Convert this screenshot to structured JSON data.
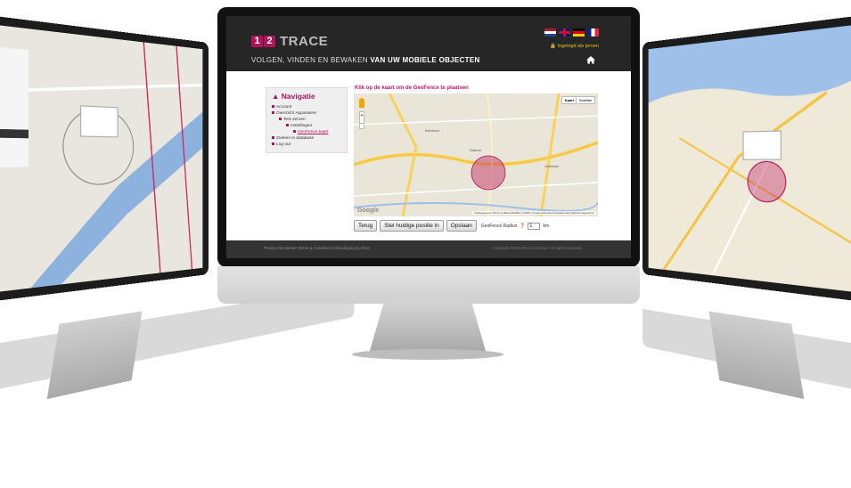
{
  "brand": {
    "logo_digit_1": "1",
    "logo_digit_2": "2",
    "logo_word": "TRACE",
    "tagline_normal": "VOLGEN, VINDEN EN BEWAKEN",
    "tagline_bold": "VAN UW MOBIELE OBJECTEN",
    "accent_color": "#b0125a",
    "header_color": "#262626"
  },
  "header": {
    "languages": [
      "nl",
      "en",
      "de",
      "fr"
    ],
    "login_status": "Ingelogd als jeroen",
    "home_icon": "home-icon"
  },
  "sidebar": {
    "title": "Navigatie",
    "items": [
      {
        "label": "Account",
        "level": 0
      },
      {
        "label": "Overzicht Apparatere",
        "level": 0
      },
      {
        "label": "Test Jeroen",
        "level": 1
      },
      {
        "label": "Instellingen",
        "level": 2
      },
      {
        "label": "GeoFence kaart",
        "level": 3,
        "active": true
      },
      {
        "label": "Zoeken in database",
        "level": 0
      },
      {
        "label": "Log out",
        "level": 0
      }
    ]
  },
  "map": {
    "instruction": "Klik op de kaart om de GeoFence te plaatsen",
    "type_map": "Kaart",
    "type_satellite": "Satelliet",
    "zoom_in": "+",
    "zoom_out": "−",
    "google_logo": "Google",
    "attribution": "Kaartgegevens ©2014 GeoBasis-DE/BKG (©2009), Google   Gebruiksvoorwaarden   Een kaartfout rapporteren",
    "places": [
      "Oudebosch",
      "Saaksum",
      "Molenbuurt"
    ]
  },
  "controls": {
    "back": "Terug",
    "set_current": "Stel huidige positie in",
    "save": "Opslaan",
    "radius_label": "GeoFence Radius",
    "radius_value": "1",
    "radius_unit": "km"
  },
  "footer": {
    "links": "Privacy   Disclaimer   Terms & Conditions   Afkondiging bij 2012",
    "copyright": "Copyright 2005-2014 123-trace. All rights reserved."
  }
}
